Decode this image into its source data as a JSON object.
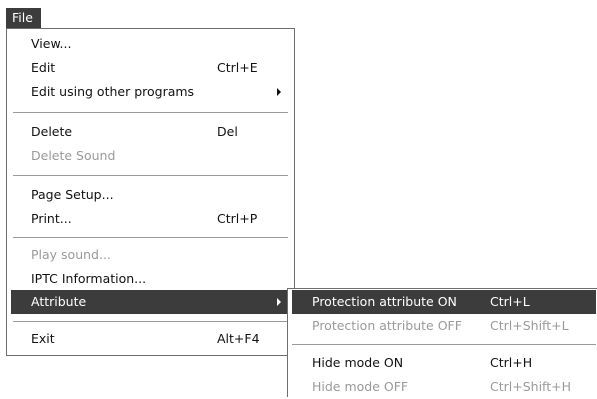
{
  "menubar": {
    "file_label": "File"
  },
  "file_menu": {
    "view": "View...",
    "edit": "Edit",
    "edit_sc": "Ctrl+E",
    "edit_other": "Edit using other programs",
    "delete": "Delete",
    "delete_sc": "Del",
    "delete_sound": "Delete Sound",
    "page_setup": "Page Setup...",
    "print": "Print...",
    "print_sc": "Ctrl+P",
    "play_sound": "Play sound...",
    "iptc": "IPTC Information...",
    "attribute": "Attribute",
    "exit": "Exit",
    "exit_sc": "Alt+F4"
  },
  "attribute_submenu": {
    "prot_on": "Protection attribute ON",
    "prot_on_sc": "Ctrl+L",
    "prot_off": "Protection attribute OFF",
    "prot_off_sc": "Ctrl+Shift+L",
    "hide_on": "Hide mode ON",
    "hide_on_sc": "Ctrl+H",
    "hide_off": "Hide mode OFF",
    "hide_off_sc": "Ctrl+Shift+H"
  },
  "colors": {
    "highlight": "#3c3c3c",
    "disabled_text": "#9a9a9a",
    "menu_bg": "#ffffff"
  }
}
